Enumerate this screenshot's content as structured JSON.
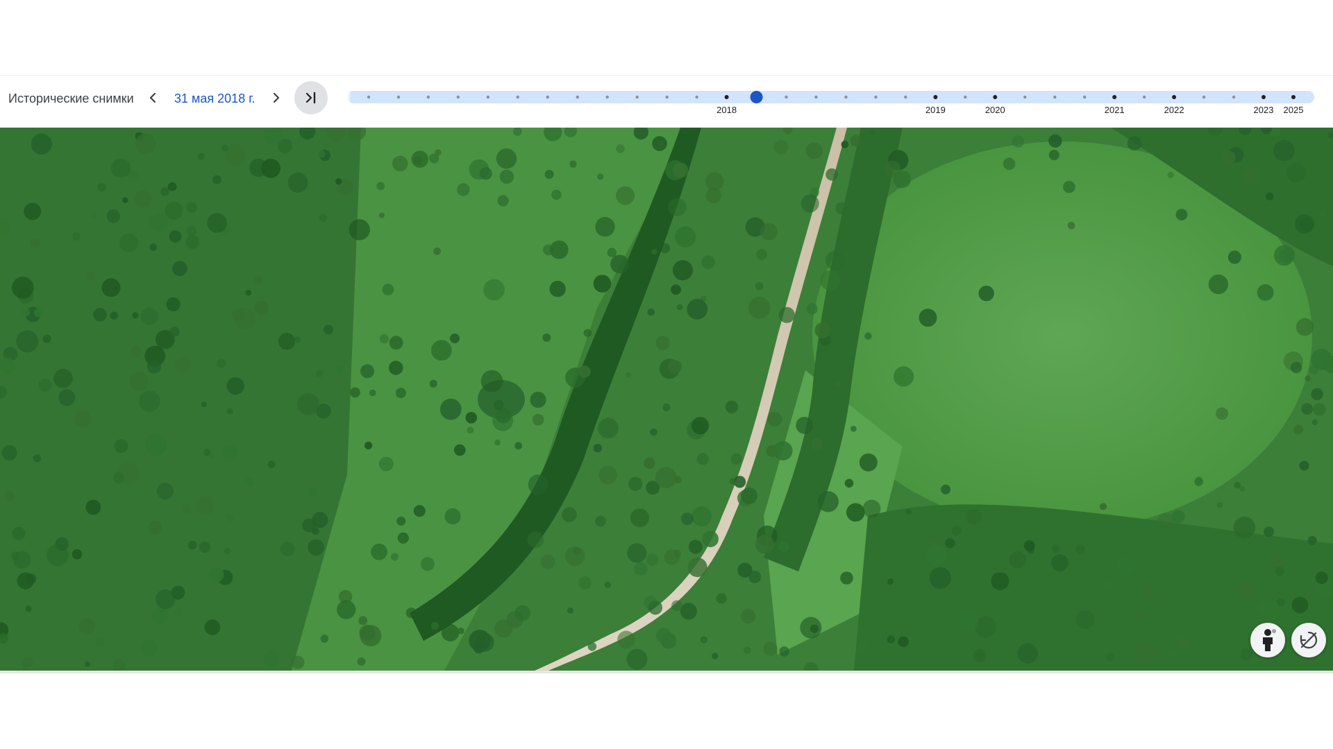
{
  "toolbar": {
    "title": "Исторические снимки",
    "current_date": "31 мая 2018 г.",
    "prev_icon": "chevron-left-icon",
    "next_icon": "chevron-right-icon",
    "latest_icon": "skip-to-latest-icon"
  },
  "timeline": {
    "accent_color": "#1a56c8",
    "track_color": "#d2e3fc",
    "selected_index": 13,
    "total_points": 32,
    "year_labels": [
      "2018",
      "2019",
      "2020",
      "2021",
      "2022",
      "2023",
      "2025"
    ],
    "year_label_point_index": [
      12,
      19,
      21,
      25,
      27,
      30,
      31
    ]
  },
  "map": {
    "type": "satellite",
    "controls": [
      "pegman-icon",
      "rotate-disabled-icon"
    ]
  }
}
